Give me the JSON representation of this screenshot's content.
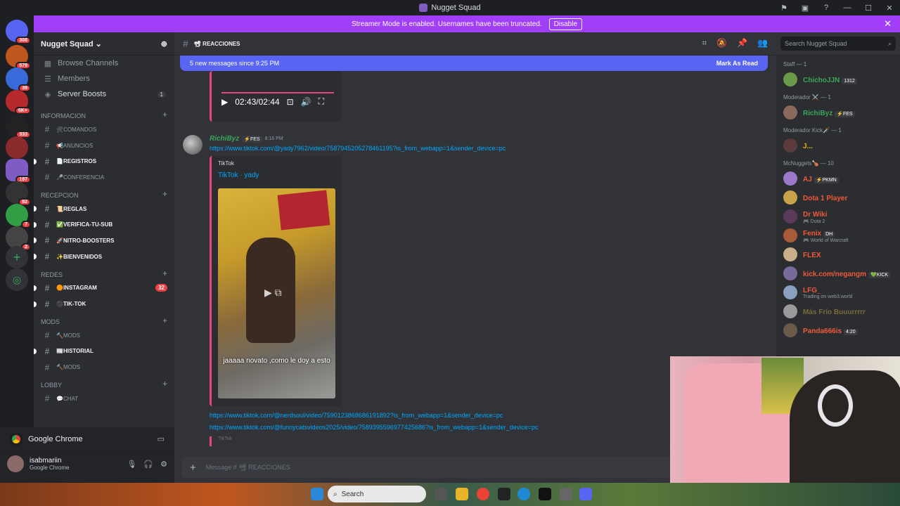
{
  "window": {
    "title": "Nugget Squad"
  },
  "banner": {
    "text": "Streamer Mode is enabled. Usernames have been truncated.",
    "button": "Disable"
  },
  "guild_badges": [
    "308",
    "579",
    "39",
    "6K+",
    "333",
    "197",
    "92",
    "7",
    "2"
  ],
  "server": {
    "name": "Nugget Squad",
    "top_items": [
      {
        "label": "Browse Channels",
        "icon": "browse-icon"
      },
      {
        "label": "Members",
        "icon": "members-icon"
      },
      {
        "label": "Server Boosts",
        "icon": "boost-icon",
        "badge": "1"
      }
    ],
    "categories": [
      {
        "name": "INFORMACION",
        "channels": [
          {
            "name": "🛠COMANDOS",
            "unread": false
          },
          {
            "name": "📢ANUNCIOS",
            "unread": false
          },
          {
            "name": "📄REGISTROS",
            "unread": true
          },
          {
            "name": "🎤CONFERENCIA",
            "unread": false
          }
        ]
      },
      {
        "name": "RECEPCION",
        "channels": [
          {
            "name": "📜REGLAS",
            "unread": true
          },
          {
            "name": "✅VERIFICA-TU-SUB",
            "unread": true
          },
          {
            "name": "🚀NITRO-BOOSTERS",
            "unread": true
          },
          {
            "name": "✨BIENVENIDOS",
            "unread": true
          }
        ]
      },
      {
        "name": "REDES",
        "channels": [
          {
            "name": "🟠INSTAGRAM",
            "unread": true,
            "count": "32"
          },
          {
            "name": "⚫TIK-TOK",
            "unread": true
          }
        ]
      },
      {
        "name": "MODS",
        "channels": [
          {
            "name": "🔨MODS",
            "unread": false
          },
          {
            "name": "📰HISTORIAL",
            "unread": true
          },
          {
            "name": "🔨MODS",
            "unread": false
          }
        ]
      },
      {
        "name": "LOBBY",
        "channels": [
          {
            "name": "💬CHAT",
            "unread": false
          }
        ]
      }
    ]
  },
  "activity": {
    "app": "Google Chrome"
  },
  "user": {
    "name": "isabmariin",
    "status": "Google Chrome"
  },
  "channel": {
    "name": "📽 REACCIONES"
  },
  "new_messages": {
    "text": "5 new messages since 9:25 PM",
    "action": "Mark As Read"
  },
  "video": {
    "time": "02:43/02:44"
  },
  "message": {
    "author": "RichiByz",
    "tag": "⚡FES",
    "time": "8:16 PM",
    "link1": "https://www.tiktok.com/@yady7962/video/7587945205278461195?is_from_webapp=1&sender_device=pc",
    "embed_provider": "TikTok",
    "embed_title": "TikTok · yady",
    "caption": "jaaaaa novato ,como le doy a esto",
    "link2": "https://www.tiktok.com/@nerdsoul/video/7590123868686191892?is_from_webapp=1&sender_device=pc",
    "link3": "https://www.tiktok.com/@funnycatsvideos2025/video/7589395596977425686?is_from_webapp=1&sender_device=pc",
    "embed2_provider": "TikTok"
  },
  "composer": {
    "placeholder": "Message # 📽 REACCIONES"
  },
  "search": {
    "placeholder": "Search Nugget Squad"
  },
  "member_groups": [
    {
      "title": "Staff — 1",
      "members": [
        {
          "name": "ChichoJJN",
          "tag": "1312",
          "color": "#3ba55c"
        }
      ]
    },
    {
      "title": "Moderador ⚔️ — 1",
      "members": [
        {
          "name": "RichiByz",
          "tag": "⚡FES",
          "color": "#3ba55c"
        }
      ]
    },
    {
      "title": "Moderador Kick🗡️ — 1",
      "members": [
        {
          "name": "J...",
          "color": "#e6b800"
        }
      ]
    },
    {
      "title": "McNuggets🍗 — 10",
      "members": [
        {
          "name": "AJ",
          "tag": "⚡PKMN",
          "color": "#f0583a"
        },
        {
          "name": "Dota 1 Player",
          "color": "#f0583a"
        },
        {
          "name": "Dr Wiki",
          "sub": "🎮 Dota 2",
          "color": "#f0583a"
        },
        {
          "name": "Fenix",
          "tag": "DH",
          "sub": "🎮 World of Warcraft",
          "color": "#f0583a"
        },
        {
          "name": "FLEX",
          "color": "#f0583a"
        },
        {
          "name": "kick.com/negangm",
          "tag": "💚KICK",
          "color": "#f0583a"
        },
        {
          "name": "LFG_",
          "sub": "Trading on web3.world",
          "color": "#f0583a"
        },
        {
          "name": "Más Frío Buuurrrrr",
          "color": "#7a6a3a"
        },
        {
          "name": "Panda666is",
          "tag": "4:20",
          "color": "#f0583a"
        }
      ]
    }
  ],
  "taskbar": {
    "search": "Search"
  },
  "colors": {
    "accent": "#5865f2",
    "banner": "#a13ef7",
    "embed_border": "#e9457a",
    "link": "#00a8fc"
  }
}
